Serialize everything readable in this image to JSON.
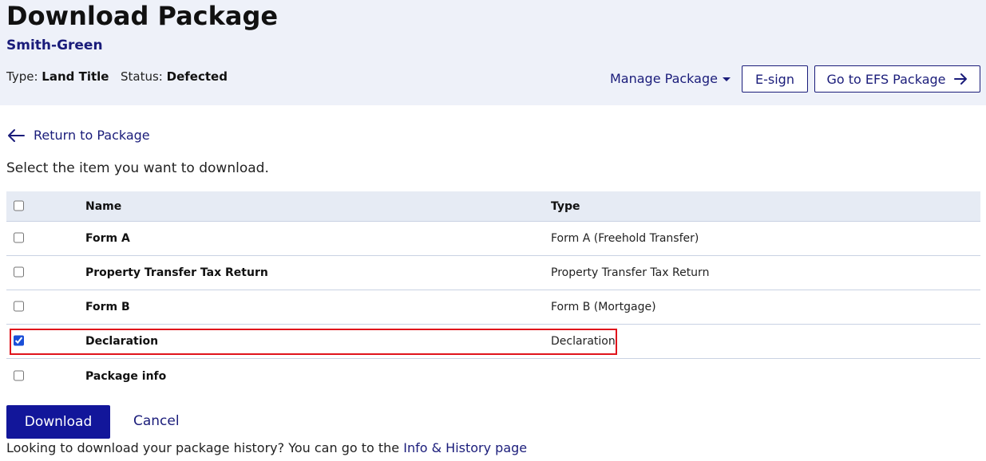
{
  "header": {
    "title": "Download Package",
    "subtitle": "Smith-Green",
    "type_label": "Type:",
    "type_value": "Land Title",
    "status_label": "Status:",
    "status_value": "Defected",
    "manage_label": "Manage Package",
    "esign_label": "E-sign",
    "efs_label": "Go to EFS Package"
  },
  "nav": {
    "return_label": "Return to Package"
  },
  "instructions": "Select the item you want to download.",
  "table": {
    "headers": {
      "name": "Name",
      "type": "Type"
    },
    "header_checked": false,
    "rows": [
      {
        "name": "Form A",
        "type": "Form A (Freehold Transfer)",
        "checked": false
      },
      {
        "name": "Property Transfer Tax Return",
        "type": "Property Transfer Tax Return",
        "checked": false
      },
      {
        "name": "Form B",
        "type": "Form B (Mortgage)",
        "checked": false
      },
      {
        "name": "Declaration",
        "type": "Declaration",
        "checked": true
      },
      {
        "name": "Package info",
        "type": "",
        "checked": false
      }
    ]
  },
  "actions": {
    "download_label": "Download",
    "cancel_label": "Cancel"
  },
  "footer": {
    "history_text": "Looking to download your package history? You can go to the",
    "history_link": "Info & History page"
  },
  "icons": {
    "manage": "caret-down-icon",
    "efs": "arrow-right-icon",
    "return": "arrow-left-icon"
  },
  "colors": {
    "accent": "#12169a",
    "link": "#1a1c7a",
    "header_bg": "#eef1f9",
    "table_header_bg": "#e6ebf4",
    "highlight": "#e0141c"
  }
}
